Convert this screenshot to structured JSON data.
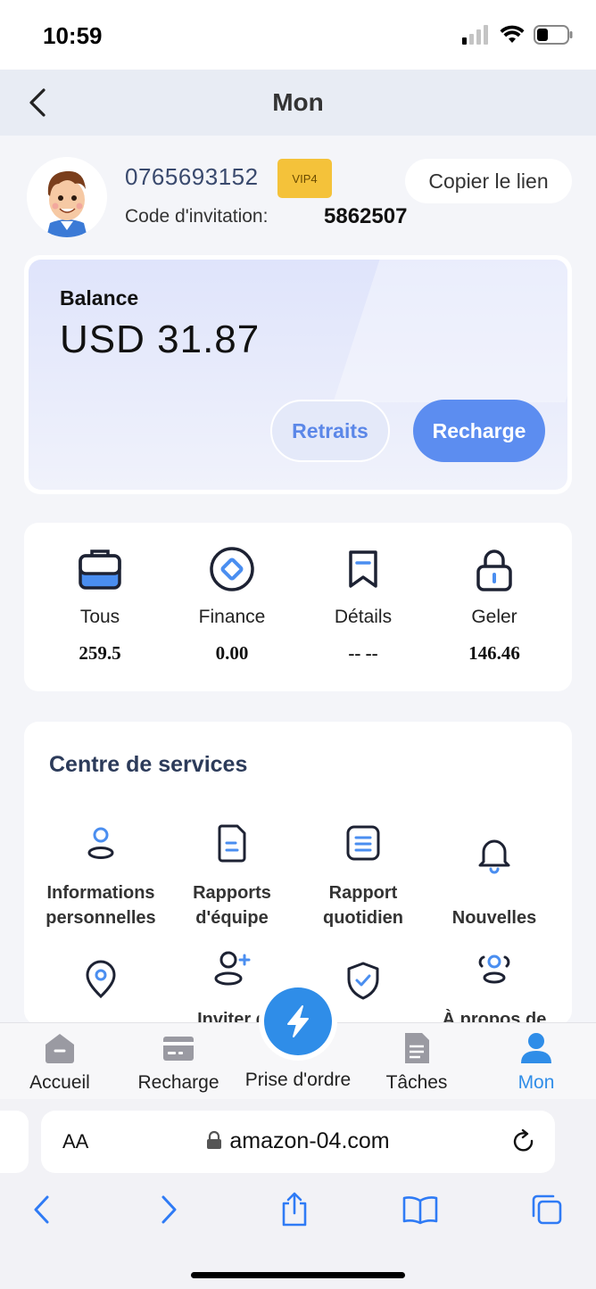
{
  "status_bar": {
    "time": "10:59"
  },
  "header": {
    "title": "Mon"
  },
  "profile": {
    "phone": "0765693152",
    "vip_badge": "VIP4",
    "copy_link_label": "Copier le lien",
    "invite_label": "Code d'invitation:",
    "invite_code": "5862507"
  },
  "balance": {
    "label": "Balance",
    "value": "USD 31.87",
    "withdraw_label": "Retraits",
    "recharge_label": "Recharge"
  },
  "stats": [
    {
      "label": "Tous",
      "value": "259.5",
      "icon": "briefcase-icon"
    },
    {
      "label": "Finance",
      "value": "0.00",
      "icon": "finance-icon"
    },
    {
      "label": "Détails",
      "value": "-- --",
      "icon": "bookmark-icon"
    },
    {
      "label": "Geler",
      "value": "146.46",
      "icon": "lock-icon"
    }
  ],
  "services": {
    "title": "Centre de services",
    "items": [
      {
        "label": "Informations personnelles",
        "icon": "user-icon"
      },
      {
        "label": "Rapports d'équipe",
        "icon": "document-icon"
      },
      {
        "label": "Rapport quotidien",
        "icon": "list-icon"
      },
      {
        "label": "Nouvelles",
        "icon": "bell-icon"
      },
      {
        "label": "",
        "icon": "location-pin-icon"
      },
      {
        "label": "Inviter d",
        "icon": "add-user-icon"
      },
      {
        "label": "",
        "icon": "shield-icon"
      },
      {
        "label": "À propos de",
        "icon": "group-icon"
      }
    ]
  },
  "tab_bar": {
    "items": [
      {
        "label": "Accueil",
        "icon": "home-icon"
      },
      {
        "label": "Recharge",
        "icon": "card-icon"
      },
      {
        "label": "Prise d'ordre",
        "icon": "lightning-icon"
      },
      {
        "label": "Tâches",
        "icon": "file-icon"
      },
      {
        "label": "Mon",
        "icon": "person-icon"
      }
    ],
    "active": "Mon",
    "active_color": "#2f8de8"
  },
  "browser": {
    "aa_label": "AA",
    "url": "amazon-04.com"
  },
  "colors": {
    "accent": "#5c8df0",
    "vip": "#f4c23a",
    "icon_blue": "#4a8ef0",
    "icon_dark": "#1d2233"
  }
}
